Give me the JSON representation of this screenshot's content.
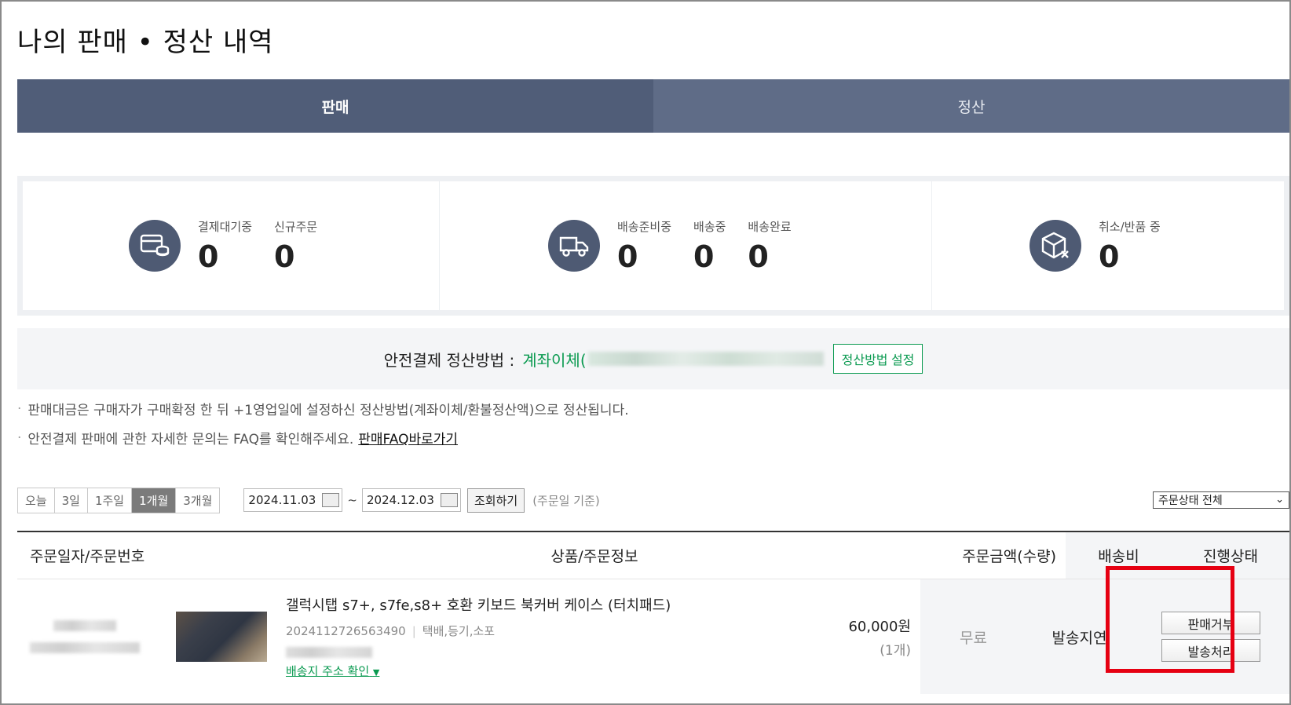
{
  "page_title": "나의 판매 • 정산 내역",
  "tabs": [
    {
      "label": "판매",
      "active": true
    },
    {
      "label": "정산",
      "active": false
    }
  ],
  "summary": {
    "payment": {
      "icon": "card-coins-icon",
      "items": [
        {
          "label": "결제대기중",
          "value": "0"
        },
        {
          "label": "신규주문",
          "value": "0"
        }
      ]
    },
    "delivery": {
      "icon": "truck-icon",
      "items": [
        {
          "label": "배송준비중",
          "value": "0"
        },
        {
          "label": "배송중",
          "value": "0"
        },
        {
          "label": "배송완료",
          "value": "0"
        }
      ]
    },
    "cancel": {
      "icon": "box-cancel-icon",
      "items": [
        {
          "label": "취소/반품 중",
          "value": "0"
        }
      ]
    }
  },
  "settlement": {
    "label": "안전결제 정산방법 :",
    "value": "계좌이체(",
    "button": "정산방법 설정"
  },
  "notes": [
    "판매대금은 구매자가 구매확정 한 뒤 +1영업일에 설정하신 정산방법(계좌이체/환불정산액)으로 정산됩니다.",
    "안전결제 판매에 관한 자세한 문의는 FAQ를 확인해주세요."
  ],
  "faq_link": "판매FAQ바로가기",
  "filter": {
    "periods": [
      "오늘",
      "3일",
      "1주일",
      "1개월",
      "3개월"
    ],
    "selected_period": "1개월",
    "date_from": "2024.11.03",
    "date_to": "2024.12.03",
    "tilde": "~",
    "search_button": "조회하기",
    "basis": "(주문일 기준)",
    "status_select": "주문상태 전체"
  },
  "table": {
    "headers": {
      "order": "주문일자/주문번호",
      "product": "상품/주문정보",
      "price": "주문금액(수량)",
      "shipping": "배송비",
      "progress": "진행상태"
    },
    "rows": [
      {
        "product_name": "갤럭시탭 s7+, s7fe,s8+ 호환 키보드 북커버 케이스 (터치패드)",
        "order_no": "2024112726563490",
        "delivery_methods": "택배,등기,소포",
        "address_link": "배송지 주소 확인",
        "price": "60,000원",
        "qty": "(1개)",
        "shipping_fee": "무료",
        "status": "발송지연",
        "actions": [
          "판매거부",
          "발송처리"
        ]
      }
    ]
  },
  "colors": {
    "tab_active": "#505d78",
    "tab_inactive": "#5f6c87",
    "accent_green": "#0a9a50",
    "highlight_red": "#e60012"
  }
}
